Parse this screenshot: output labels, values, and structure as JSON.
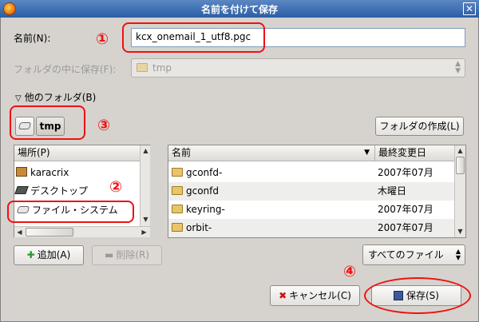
{
  "window": {
    "title": "名前を付けて保存",
    "close_glyph": "✕"
  },
  "name_row": {
    "label": "名前(N):",
    "value": "kcx_onemail_1_utf8.pgc"
  },
  "save_in_row": {
    "label": "フォルダの中に保存(F):",
    "value": "tmp"
  },
  "other_folders": {
    "label": "他のフォルダ(B)"
  },
  "path_bar": {
    "current": "tmp",
    "create_folder_label": "フォルダの作成(L)"
  },
  "places": {
    "header": "場所(P)",
    "items": [
      {
        "label": "karacrix",
        "icon": "home-icon"
      },
      {
        "label": "デスクトップ",
        "icon": "desktop-icon"
      },
      {
        "label": "ファイル・システム",
        "icon": "drive-icon"
      }
    ],
    "add_label": "追加(A)",
    "remove_label": "削除(R)"
  },
  "files": {
    "col_name": "名前",
    "col_modified": "最終変更日",
    "rows": [
      {
        "name": "gconfd-",
        "modified": "2007年07月"
      },
      {
        "name": "gconfd",
        "modified": "木曜日"
      },
      {
        "name": "keyring-",
        "modified": "2007年07月"
      },
      {
        "name": "orbit-",
        "modified": "2007年07月"
      }
    ]
  },
  "filter": {
    "value": "すべてのファイル"
  },
  "actions": {
    "cancel_label": "キャンセル(C)",
    "save_label": "保存(S)"
  },
  "annotations": {
    "n1": "①",
    "n2": "②",
    "n3": "③",
    "n4": "④"
  },
  "colors": {
    "annotation": "#ee1111",
    "titlebar": "#2b5ea6",
    "selection": "#ffffff"
  }
}
